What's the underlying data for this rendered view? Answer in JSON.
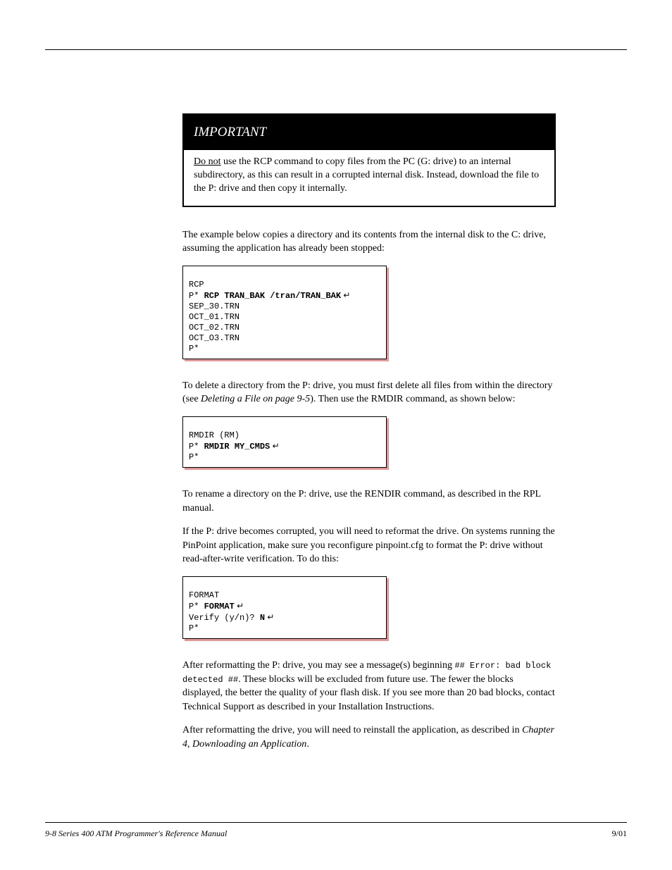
{
  "warning": {
    "title": "IMPORTANT",
    "body_prefix": "Do not",
    "body_rest": " use the RCP command to copy files from the PC (G: drive) to an internal subdirectory, as this can result in a corrupted internal disk. Instead, download the file to the P: drive and then copy it internally."
  },
  "paragraphs": {
    "p1": "The example below copies a directory and its contents from the internal disk to the C: drive, assuming the application has already been stopped:",
    "p2_prefix": "To delete a directory from the P: drive, you must first delete all files from within the directory (see ",
    "p2_link": "Deleting a File on page 9-5",
    "p2_suffix": "). Then use the RMDIR command, as shown below:",
    "p3": "To rename a directory on the P: drive, use the RENDIR command, as described in the RPL manual.",
    "p4": "If the P: drive becomes corrupted, you will need to reformat the drive. On systems running the PinPoint application, make sure you reconfigure pinpoint.cfg to format the P: drive without read-after-write verification. To do this:",
    "p5_prefix": "After reformatting the P: drive, you may see a message(s) beginning ",
    "p5_code": "## Error: bad block detected ##",
    "p5_suffix": ". These blocks will be excluded from future use. The fewer the blocks displayed, the better the quality of your flash disk. If you see more than 20 bad blocks, contact Technical Support as described in your Installation Instructions.",
    "p6_prefix": "After reformatting the drive, you will need to reinstall the application, as described in ",
    "p6_link": "Chapter 4, Downloading an Application",
    "p6_suffix": "."
  },
  "codebox1": {
    "l1": "RCP",
    "l2_prefix": "P* ",
    "l2_bold": "RCP TRAN_BAK /tran/TRAN_BAK",
    "l2_suffix": " ↵",
    "l3": "SEP_30.TRN",
    "l4": "OCT_01.TRN",
    "l5": "OCT_02.TRN",
    "l6": "OCT_O3.TRN",
    "l7": "P*"
  },
  "codebox2": {
    "l1": "RMDIR (RM)",
    "l2": "",
    "l3_prefix": "P* ",
    "l3_bold": "RMDIR MY_CMDS",
    "l3_suffix": " ↵",
    "l4": "P*"
  },
  "codebox3": {
    "l1": "FORMAT",
    "l2": "",
    "l3_prefix": "P* ",
    "l3_bold": "FORMAT",
    "l3_suffix": " ↵",
    "l4_prefix": "Verify (y/n)? ",
    "l4_bold": "N",
    "l4_suffix": " ↵",
    "l5": "P*"
  },
  "footer": {
    "left": "9-8   Series 400 ATM Programmer's Reference Manual",
    "right": "9/01"
  }
}
